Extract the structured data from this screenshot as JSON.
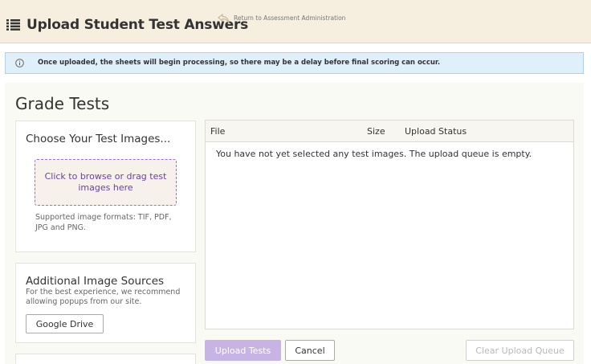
{
  "header": {
    "title": "Upload Student Test Answers",
    "return_link": "Return to Assessment Administration",
    "menu_icon": "list-icon",
    "return_icon": "return-arrow-icon"
  },
  "info_banner": {
    "icon": "info-icon",
    "message": "Once uploaded, the sheets will begin processing, so there may be a delay before final scoring can occur."
  },
  "main": {
    "title": "Grade Tests",
    "choose_images": {
      "title": "Choose Your Test Images...",
      "dropzone_label": "Click to browse or drag test images here",
      "formats_note": "Supported image formats: TIF, PDF, JPG and PNG."
    },
    "additional_sources": {
      "title": "Additional Image Sources",
      "note": "For the best experience, we recommend allowing popups from our site.",
      "google_drive_label": "Google Drive"
    },
    "queue": {
      "columns": [
        "File",
        "Size",
        "Upload Status"
      ],
      "empty_message": "You have not yet selected any test images. The upload queue is empty."
    },
    "actions": {
      "upload_label": "Upload Tests",
      "cancel_label": "Cancel",
      "clear_label": "Clear Upload Queue"
    }
  },
  "colors": {
    "header_bg": "#f6eedf",
    "banner_bg": "#dff0fb",
    "accent": "#6b3fa0",
    "upload_disabled": "#c7b4e4"
  }
}
